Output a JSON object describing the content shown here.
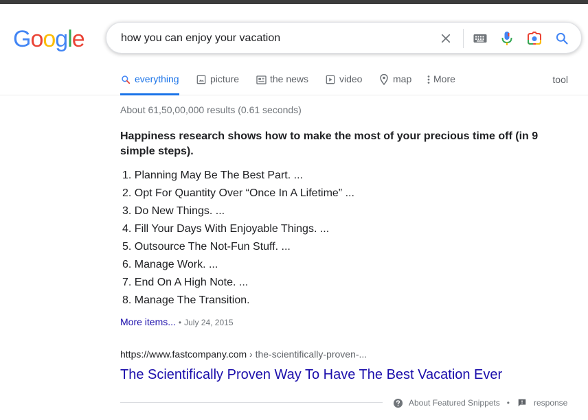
{
  "logo": {
    "letters": [
      "G",
      "o",
      "o",
      "g",
      "l",
      "e"
    ],
    "colors": [
      "#4285F4",
      "#EA4335",
      "#FBBC05",
      "#4285F4",
      "#34A853",
      "#EA4335"
    ]
  },
  "search": {
    "query": "how you can enjoy your vacation",
    "icons": [
      "close-icon",
      "keyboard-icon",
      "mic-icon",
      "camera-icon",
      "search-icon"
    ]
  },
  "tabs": [
    {
      "label": "everything",
      "icon": "search-icon",
      "active": true
    },
    {
      "label": "picture",
      "icon": "image-icon"
    },
    {
      "label": "the news",
      "icon": "news-icon"
    },
    {
      "label": "video",
      "icon": "play-icon"
    },
    {
      "label": "map",
      "icon": "map-pin-icon"
    },
    {
      "label": "More",
      "icon": "more-vert-icon"
    }
  ],
  "tools_label": "tool",
  "results_stats": "About 61,50,00,000 results (0.61 seconds)",
  "snippet": {
    "heading": "Happiness research shows how to make the most of your precious time off (in 9 simple steps).",
    "items": [
      "1. Planning May Be The Best Part. ...",
      "2. Opt For Quantity Over “Once In A Lifetime” ...",
      "3. Do New Things. ...",
      "4. Fill Your Days With Enjoyable Things. ...",
      "5. Outsource The Not-Fun Stuff. ...",
      "6. Manage Work. ...",
      "7. End On A High Note. ...",
      "8. Manage The Transition."
    ],
    "more_label": "More items...",
    "date_sep": "•",
    "date": "July 24, 2015"
  },
  "result": {
    "domain": "https://www.fastcompany.com",
    "path": " › the-scientifically-proven-...",
    "title": "The Scientifically Proven Way To Have The Best Vacation Ever"
  },
  "footer": {
    "about_label": "About Featured Snippets",
    "separator": "•",
    "response_label": "response"
  },
  "colors": {
    "accent": "#1a73e8",
    "link": "#1a0dab",
    "muted": "#70757a"
  }
}
